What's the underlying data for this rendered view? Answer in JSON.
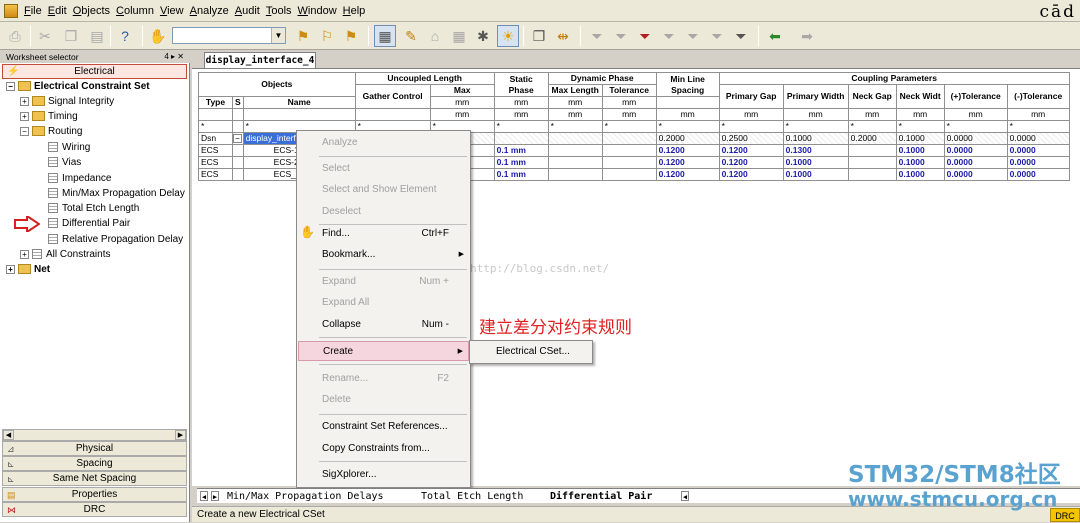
{
  "menubar": {
    "items": [
      "File",
      "Edit",
      "Objects",
      "Column",
      "View",
      "Analyze",
      "Audit",
      "Tools",
      "Window",
      "Help"
    ],
    "brand": "cād"
  },
  "left_panel": {
    "title": "Worksheet selector",
    "title_controls": "4 ▸ ✕",
    "header": "Electrical",
    "tree": [
      {
        "label": "Electrical Constraint Set",
        "bold": true,
        "level": 0,
        "expander": "−",
        "icon": "folder"
      },
      {
        "label": "Signal Integrity",
        "level": 1,
        "expander": "+",
        "icon": "folder"
      },
      {
        "label": "Timing",
        "level": 1,
        "expander": "+",
        "icon": "folder"
      },
      {
        "label": "Routing",
        "level": 1,
        "expander": "−",
        "icon": "folder"
      },
      {
        "label": "Wiring",
        "level": 2,
        "icon": "sheet"
      },
      {
        "label": "Vias",
        "level": 2,
        "icon": "sheet"
      },
      {
        "label": "Impedance",
        "level": 2,
        "icon": "sheet"
      },
      {
        "label": "Min/Max Propagation Delay",
        "level": 2,
        "icon": "sheet"
      },
      {
        "label": "Total Etch Length",
        "level": 2,
        "icon": "sheet"
      },
      {
        "label": "Differential Pair",
        "level": 2,
        "icon": "sheet",
        "highlighted": true
      },
      {
        "label": "Relative Propagation Delay",
        "level": 2,
        "icon": "sheet"
      },
      {
        "label": "All Constraints",
        "level": 1,
        "expander": "+",
        "icon": "sheet"
      },
      {
        "label": "Net",
        "bold": true,
        "level": 0,
        "expander": "+",
        "icon": "folder"
      }
    ],
    "category_tabs": [
      "Physical",
      "Spacing",
      "Same Net Spacing",
      "Properties",
      "DRC"
    ]
  },
  "document": {
    "tab": "display_interface_4"
  },
  "grid": {
    "headers": {
      "objects": "Objects",
      "uncoupled_length": "Uncoupled Length",
      "static_phase": "Static Phase",
      "dynamic_phase": "Dynamic Phase",
      "min_line_spacing": "Min Line Spacing",
      "coupling_parameters": "Coupling Parameters",
      "type": "Type",
      "s": "S",
      "name": "Name",
      "gather_control": "Gather Control",
      "max": "Max",
      "tolerance": "Tolerance",
      "max_length": "Max Length",
      "dp_tolerance": "Tolerance",
      "primary_gap": "Primary Gap",
      "primary_width": "Primary Width",
      "neck_gap": "Neck Gap",
      "neck_width": "Neck Widt",
      "plus_tolerance": "(+)Tolerance",
      "minus_tolerance": "(-)Tolerance"
    },
    "unit_mm": "mm",
    "filter": "*",
    "rows": [
      {
        "type": "Dsn",
        "expander": "−",
        "name": "display_interface_4",
        "selected": true,
        "static": "",
        "min_line": "0.2000",
        "pgap": "0.2500",
        "pwidth": "0.1000",
        "neckgap": "0.2000",
        "neckwidth": "0.1000",
        "ptol": "0.0000",
        "mtol": "0.0000"
      },
      {
        "type": "ECS",
        "name": "ECS-1",
        "static": "0.1 mm",
        "min_line": "0.1200",
        "pgap": "0.1200",
        "pwidth": "0.1300",
        "neckgap": "",
        "neckwidth": "0.1000",
        "ptol": "0.0000",
        "mtol": "0.0000"
      },
      {
        "type": "ECS",
        "name": "ECS-2",
        "static": "0.1 mm",
        "min_line": "0.1200",
        "pgap": "0.1200",
        "pwidth": "0.1000",
        "neckgap": "",
        "neckwidth": "0.1000",
        "ptol": "0.0000",
        "mtol": "0.0000"
      },
      {
        "type": "ECS",
        "name": "ECS_",
        "static": "0.1 mm",
        "min_line": "0.1200",
        "pgap": "0.1200",
        "pwidth": "0.1000",
        "neckgap": "",
        "neckwidth": "0.1000",
        "ptol": "0.0000",
        "mtol": "0.0000"
      }
    ]
  },
  "context_menu": {
    "items": [
      {
        "label": "Analyze",
        "disabled": true
      },
      {
        "label": "Select",
        "disabled": true
      },
      {
        "label": "Select and Show Element",
        "disabled": true
      },
      {
        "label": "Deselect",
        "disabled": true
      },
      {
        "label": "Find...",
        "shortcut": "Ctrl+F"
      },
      {
        "label": "Bookmark...",
        "submenu": true
      },
      {
        "label": "Expand",
        "disabled": true,
        "shortcut": "Num +"
      },
      {
        "label": "Expand All",
        "disabled": true
      },
      {
        "label": "Collapse",
        "shortcut": "Num -"
      },
      {
        "label": "Create",
        "submenu": true,
        "highlighted": true
      },
      {
        "label": "Rename...",
        "disabled": true,
        "shortcut": "F2"
      },
      {
        "label": "Delete",
        "disabled": true
      },
      {
        "label": "Constraint Set References..."
      },
      {
        "label": "Copy Constraints from..."
      },
      {
        "label": "SigXplorer..."
      }
    ],
    "submenu_item": "Electrical CSet..."
  },
  "annotation": "建立差分对约束规则",
  "watermark_url": "http://blog.csdn.net/",
  "sheet_tabs": [
    "Min/Max Propagation Delays",
    "Total Etch Length",
    "Differential Pair"
  ],
  "status": {
    "text": "Create a new Electrical CSet",
    "drc": "DRC"
  },
  "watermark": {
    "line1": "STM32/STM8社区",
    "line2": "www.stmcu.org.cn"
  }
}
